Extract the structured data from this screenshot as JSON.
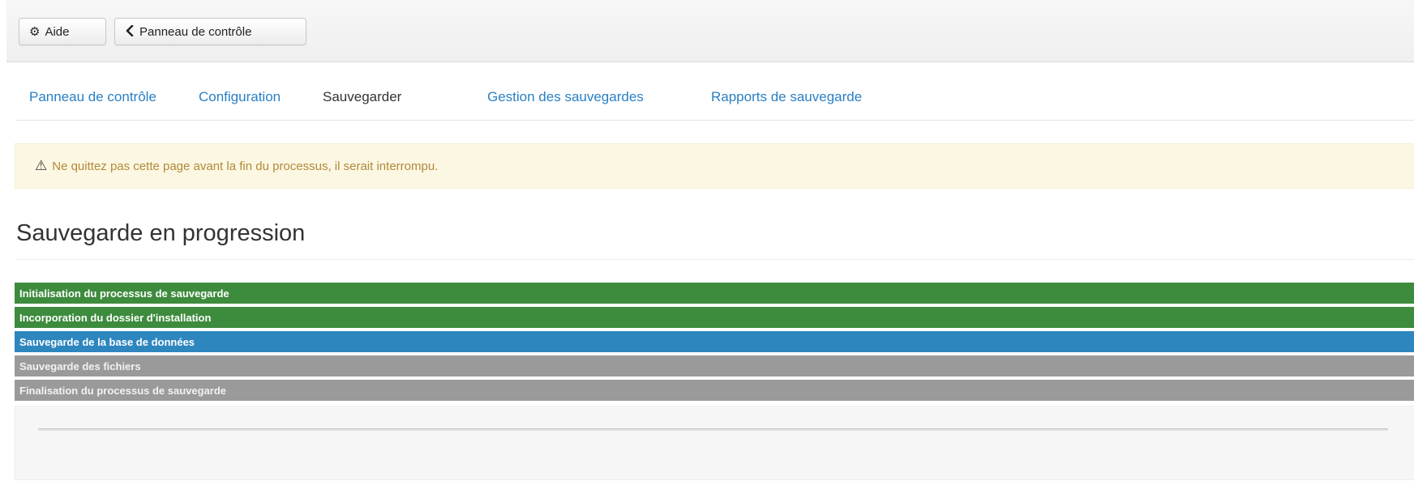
{
  "toolbar": {
    "help": {
      "label": "Aide",
      "icon": "gear-icon"
    },
    "back": {
      "label": "Panneau de contrôle",
      "icon": "chevron-left-icon"
    }
  },
  "tabs": [
    {
      "label": "Panneau de contrôle",
      "active": false
    },
    {
      "label": "Configuration",
      "active": false
    },
    {
      "label": "Sauvegarder",
      "active": true
    },
    {
      "label": "Gestion des sauvegardes",
      "active": false
    },
    {
      "label": "Rapports de sauvegarde",
      "active": false
    }
  ],
  "warning": {
    "icon": "warning-icon",
    "text": "Ne quittez pas cette page avant la fin du processus, il serait interrompu."
  },
  "main": {
    "title": "Sauvegarde en progression"
  },
  "steps": [
    {
      "label": "Initialisation du processus de sauvegarde",
      "status": "done"
    },
    {
      "label": "Incorporation du dossier d'installation",
      "status": "done"
    },
    {
      "label": "Sauvegarde de la base de données",
      "status": "active"
    },
    {
      "label": "Sauvegarde des fichiers",
      "status": "pending"
    },
    {
      "label": "Finalisation du processus de sauvegarde",
      "status": "pending"
    }
  ],
  "progress": {
    "fraction": 0
  },
  "colors": {
    "done": "#3d8b3d",
    "active": "#2e86bf",
    "pending": "#9a9a9a",
    "link": "#2a7fc4",
    "warning_bg": "#fcf7e2",
    "warning_text": "#b08a3a"
  }
}
